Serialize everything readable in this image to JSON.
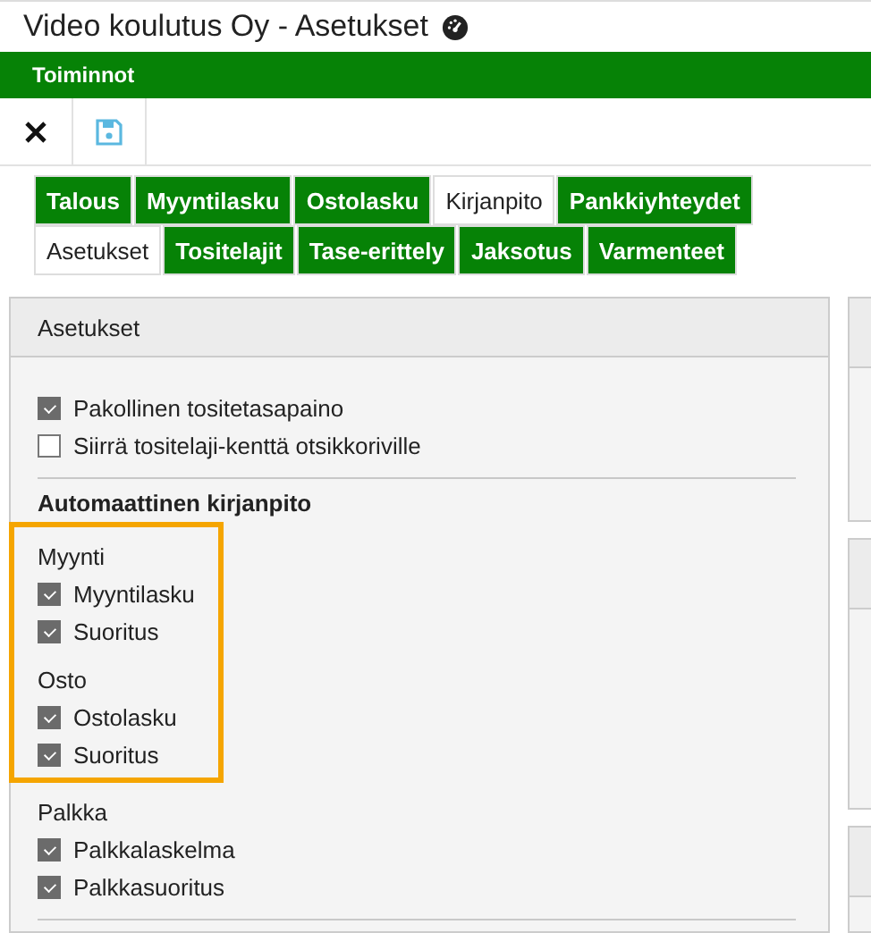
{
  "window": {
    "title": "Video koulutus Oy - Asetukset"
  },
  "menu_bar": {
    "label": "Toiminnot"
  },
  "toolbar": {
    "buttons": [
      {
        "kind": "close"
      },
      {
        "kind": "save"
      }
    ]
  },
  "tabs": [
    {
      "label": "Talous",
      "selected": false
    },
    {
      "label": "Myyntilasku",
      "selected": false
    },
    {
      "label": "Ostolasku",
      "selected": false
    },
    {
      "label": "Kirjanpito",
      "selected": true
    },
    {
      "label": "Pankkiyhteydet",
      "selected": false
    }
  ],
  "subtabs": [
    {
      "label": "Asetukset",
      "selected": true
    },
    {
      "label": "Tositelajit",
      "selected": false
    },
    {
      "label": "Tase-erittely",
      "selected": false
    },
    {
      "label": "Jaksotus",
      "selected": false
    },
    {
      "label": "Varmenteet",
      "selected": false
    }
  ],
  "panel": {
    "title": "Asetukset",
    "options": [
      {
        "label": "Pakollinen tositetasapaino",
        "checked": true
      },
      {
        "label": "Siirrä tositelaji-kenttä otsikkoriville",
        "checked": false
      }
    ],
    "section_title": "Automaattinen kirjanpito",
    "groups": [
      {
        "title": "Myynti",
        "highlighted": true,
        "items": [
          {
            "label": "Myyntilasku",
            "checked": true
          },
          {
            "label": "Suoritus",
            "checked": true
          }
        ]
      },
      {
        "title": "Osto",
        "highlighted": true,
        "items": [
          {
            "label": "Ostolasku",
            "checked": true
          },
          {
            "label": "Suoritus",
            "checked": true
          }
        ]
      },
      {
        "title": "Palkka",
        "highlighted": false,
        "items": [
          {
            "label": "Palkkalaskelma",
            "checked": true
          },
          {
            "label": "Palkkasuoritus",
            "checked": true
          }
        ]
      }
    ]
  }
}
